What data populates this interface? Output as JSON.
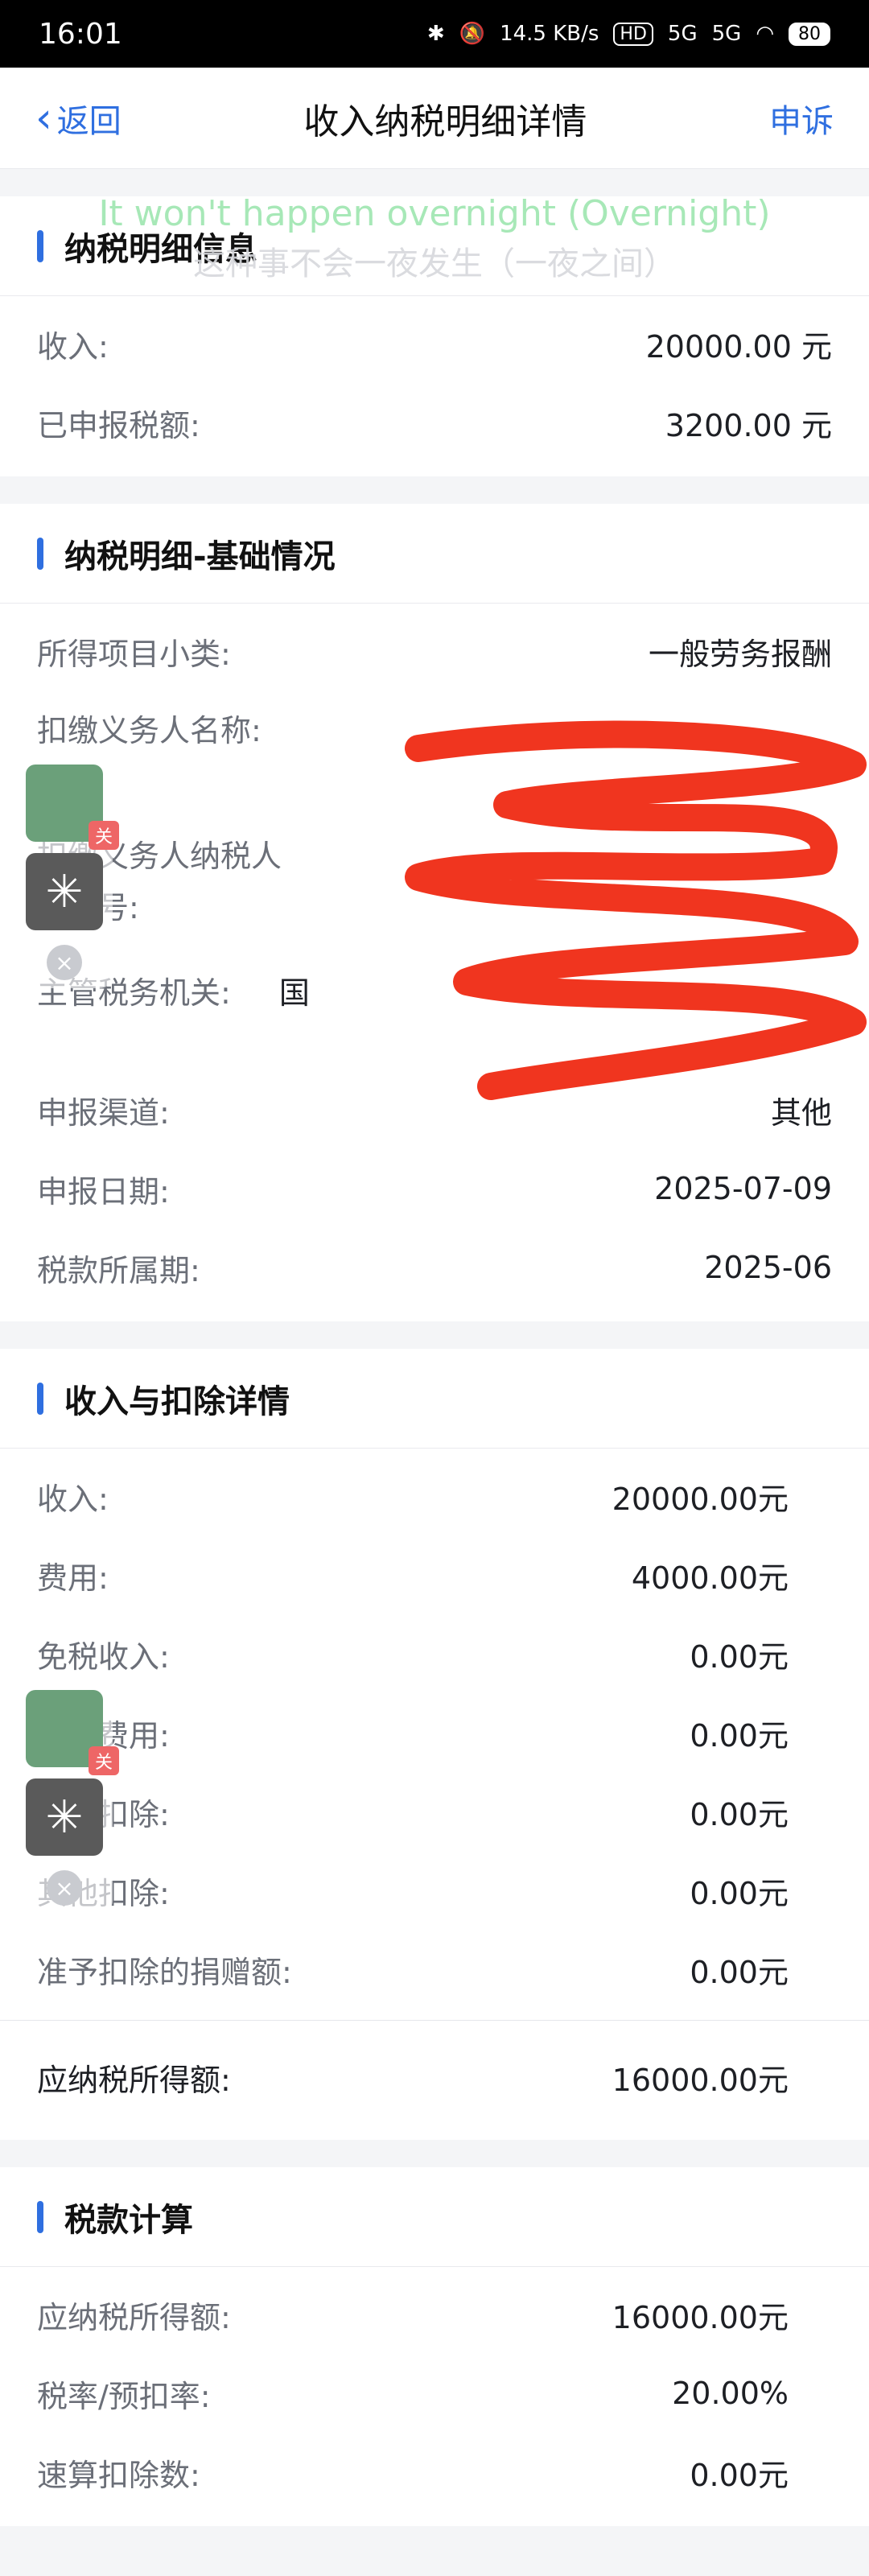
{
  "status_bar": {
    "time": "16:01",
    "net_speed": "14.5 KB/s",
    "hd": "HD",
    "sim1": "5G",
    "sim2": "5G",
    "battery": "80"
  },
  "nav": {
    "back_label": "返回",
    "title": "收入纳税明细详情",
    "action_label": "申诉"
  },
  "overlay": {
    "caption_en": "It won't happen overnight (Overnight)",
    "caption_cn": "这种事不会一夜发生（一夜之间）"
  },
  "floating_widget": {
    "badge_label": "关"
  },
  "tax_detail": {
    "title": "纳税明细信息",
    "rows": [
      {
        "label": "收入:",
        "value": "20000.00 元"
      },
      {
        "label": "已申报税额:",
        "value": "3200.00 元"
      }
    ]
  },
  "basic_info": {
    "title": "纳税明细-基础情况",
    "category_label": "所得项目小类:",
    "category_value": "一般劳务报酬",
    "withholder_name_label": "扣缴义务人名称:",
    "withholder_id_label": "扣缴义务人纳税人识别号:",
    "tax_authority_label": "主管税务机关:",
    "tax_authority_value": "国",
    "rows": [
      {
        "label": "申报渠道:",
        "value": "其他"
      },
      {
        "label": "申报日期:",
        "value": "2025-07-09"
      },
      {
        "label": "税款所属期:",
        "value": "2025-06"
      }
    ]
  },
  "income_deduction": {
    "title": "收入与扣除详情",
    "rows": [
      {
        "label": "收入:",
        "value": "20000.00元"
      },
      {
        "label": "费用:",
        "value": "4000.00元"
      },
      {
        "label": "免税收入:",
        "value": "0.00元"
      },
      {
        "label": "减除费用:",
        "value": "0.00元"
      },
      {
        "label": "专项扣除:",
        "value": "0.00元"
      },
      {
        "label": "其他扣除:",
        "value": "0.00元"
      },
      {
        "label": "准予扣除的捐赠额:",
        "value": "0.00元"
      }
    ],
    "taxable_label": "应纳税所得额:",
    "taxable_value": "16000.00元"
  },
  "tax_calc": {
    "title": "税款计算",
    "rows": [
      {
        "label": "应纳税所得额:",
        "value": "16000.00元"
      },
      {
        "label": "税率/预扣率:",
        "value": "20.00%"
      },
      {
        "label": "速算扣除数:",
        "value": "0.00元"
      }
    ]
  }
}
